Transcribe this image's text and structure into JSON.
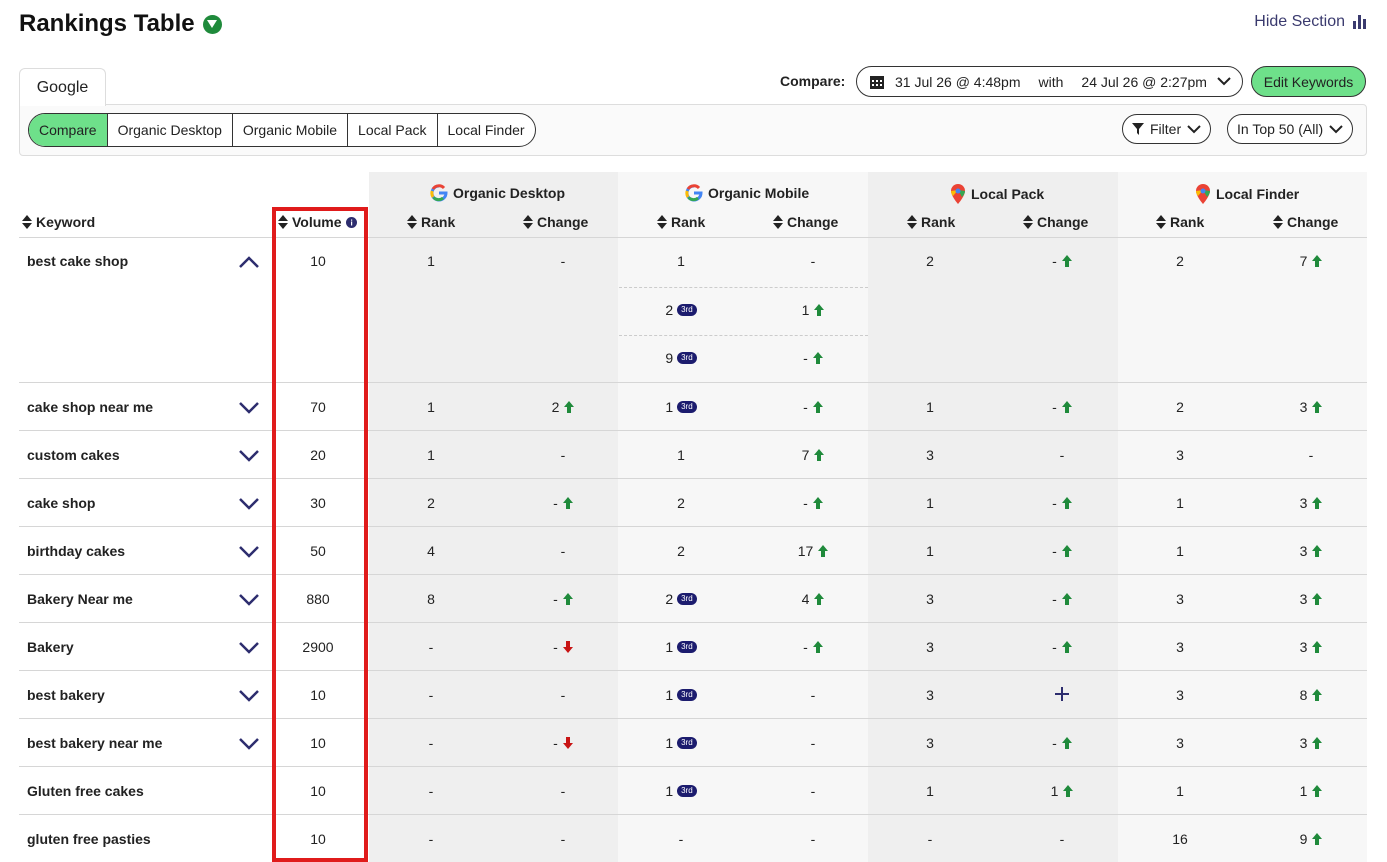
{
  "header": {
    "title": "Rankings Table",
    "hide_label": "Hide Section"
  },
  "tabs": {
    "engine": "Google"
  },
  "modes": [
    "Compare",
    "Organic Desktop",
    "Organic Mobile",
    "Local Pack",
    "Local Finder"
  ],
  "compare": {
    "label": "Compare:",
    "from": "31 Jul 26 @ 4:48pm",
    "with": "with",
    "to": "24 Jul 26 @ 2:27pm"
  },
  "edit_label": "Edit Keywords",
  "filter_label": "Filter",
  "top_label": "In Top 50 (All)",
  "columns": {
    "keyword": "Keyword",
    "volume": "Volume",
    "rank": "Rank",
    "change": "Change",
    "groups": [
      "Organic Desktop",
      "Organic Mobile",
      "Local Pack",
      "Local Finder"
    ]
  },
  "rows": [
    {
      "kw": "best cake shop",
      "vol": "10",
      "cells": [
        [
          "1",
          ""
        ],
        [
          "-",
          ""
        ],
        [
          "1",
          ""
        ],
        [
          "-",
          ""
        ],
        [
          "2",
          ""
        ],
        [
          "-",
          "up"
        ],
        [
          "2",
          ""
        ],
        [
          "7",
          "up"
        ]
      ],
      "extra": [
        [
          "2",
          "1"
        ],
        [
          "9",
          "-"
        ]
      ]
    },
    {
      "kw": "cake shop near me",
      "vol": "70",
      "cells": [
        [
          "1",
          ""
        ],
        [
          "2",
          "up"
        ],
        [
          "1",
          "b"
        ],
        [
          "-",
          "up"
        ],
        [
          "1",
          ""
        ],
        [
          "-",
          "up"
        ],
        [
          "2",
          ""
        ],
        [
          "3",
          "up"
        ]
      ]
    },
    {
      "kw": "custom cakes",
      "vol": "20",
      "cells": [
        [
          "1",
          ""
        ],
        [
          "-",
          ""
        ],
        [
          "1",
          ""
        ],
        [
          "7",
          "up"
        ],
        [
          "3",
          ""
        ],
        [
          "-",
          ""
        ],
        [
          "3",
          ""
        ],
        [
          "-",
          ""
        ]
      ]
    },
    {
      "kw": "cake shop",
      "vol": "30",
      "cells": [
        [
          "2",
          ""
        ],
        [
          "-",
          "up"
        ],
        [
          "2",
          ""
        ],
        [
          "-",
          "up"
        ],
        [
          "1",
          ""
        ],
        [
          "-",
          "up"
        ],
        [
          "1",
          ""
        ],
        [
          "3",
          "up"
        ]
      ]
    },
    {
      "kw": "birthday cakes",
      "vol": "50",
      "cells": [
        [
          "4",
          ""
        ],
        [
          "-",
          ""
        ],
        [
          "2",
          ""
        ],
        [
          "17",
          "up"
        ],
        [
          "1",
          ""
        ],
        [
          "-",
          "up"
        ],
        [
          "1",
          ""
        ],
        [
          "3",
          "up"
        ]
      ]
    },
    {
      "kw": "Bakery Near me",
      "vol": "880",
      "cells": [
        [
          "8",
          ""
        ],
        [
          "-",
          "up"
        ],
        [
          "2",
          "b"
        ],
        [
          "4",
          "up"
        ],
        [
          "3",
          ""
        ],
        [
          "-",
          "up"
        ],
        [
          "3",
          ""
        ],
        [
          "3",
          "up"
        ]
      ]
    },
    {
      "kw": "Bakery",
      "vol": "2900",
      "cells": [
        [
          "-",
          ""
        ],
        [
          "-",
          "down"
        ],
        [
          "1",
          "b"
        ],
        [
          "-",
          "up"
        ],
        [
          "3",
          ""
        ],
        [
          "-",
          "up"
        ],
        [
          "3",
          ""
        ],
        [
          "3",
          "up"
        ]
      ]
    },
    {
      "kw": "best bakery",
      "vol": "10",
      "cells": [
        [
          "-",
          ""
        ],
        [
          "-",
          ""
        ],
        [
          "1",
          "b"
        ],
        [
          "-",
          ""
        ],
        [
          "3",
          ""
        ],
        [
          "+",
          "plus"
        ],
        [
          "3",
          ""
        ],
        [
          "8",
          "up"
        ]
      ]
    },
    {
      "kw": "best bakery near me",
      "vol": "10",
      "cells": [
        [
          "-",
          ""
        ],
        [
          "-",
          "down"
        ],
        [
          "1",
          "b"
        ],
        [
          "-",
          ""
        ],
        [
          "3",
          ""
        ],
        [
          "-",
          "up"
        ],
        [
          "3",
          ""
        ],
        [
          "3",
          "up"
        ]
      ]
    },
    {
      "kw": "Gluten free cakes",
      "vol": "10",
      "cells": [
        [
          "-",
          ""
        ],
        [
          "-",
          ""
        ],
        [
          "1",
          "b"
        ],
        [
          "-",
          ""
        ],
        [
          "1",
          ""
        ],
        [
          "1",
          "up"
        ],
        [
          "1",
          ""
        ],
        [
          "1",
          "up"
        ]
      ]
    },
    {
      "kw": "gluten free pasties",
      "vol": "10",
      "cells": [
        [
          "-",
          ""
        ],
        [
          "-",
          ""
        ],
        [
          "-",
          ""
        ],
        [
          "-",
          ""
        ],
        [
          "-",
          ""
        ],
        [
          "-",
          ""
        ],
        [
          "16",
          ""
        ],
        [
          "9",
          "up"
        ]
      ]
    }
  ],
  "badge_text": "3rd",
  "colors": {
    "accent": "#6ee08a",
    "up": "#1f8a3b",
    "down": "#c81414",
    "navy": "#2d2d6e",
    "highlight": "#e01b1b"
  }
}
